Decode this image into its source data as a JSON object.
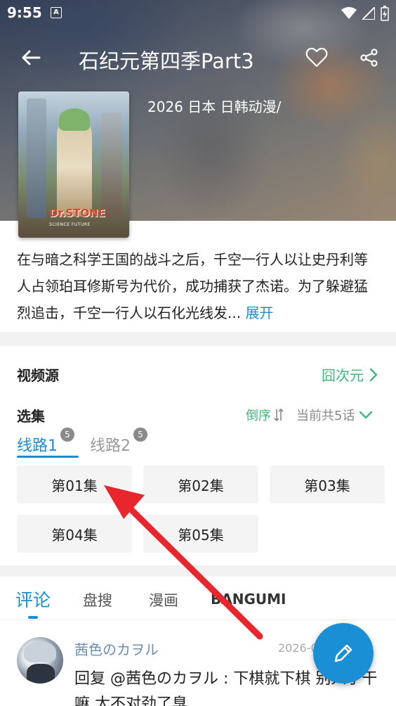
{
  "status": {
    "time": "9:55",
    "a_icon": "A"
  },
  "header": {
    "title": "石纪元第四季Part3",
    "meta": "2026 日本 日韩动漫/"
  },
  "poster": {
    "logo": "Dr.STONE",
    "subtitle": "SCIENCE FUTURE"
  },
  "description": {
    "text": "在与暗之科学王国的战斗之后，千空一行人以让史丹利等人占领珀耳修斯号为代价，成功捕获了杰诺。为了躲避猛烈追击，千空一行人以石化光线发...",
    "expand_label": "展开"
  },
  "source": {
    "label": "视频源",
    "value": "囧次元"
  },
  "episodes": {
    "label": "选集",
    "order_label": "倒序",
    "count_text": "当前共5话",
    "lines": [
      {
        "label": "线路1",
        "badge": "5"
      },
      {
        "label": "线路2",
        "badge": "5"
      }
    ],
    "items": [
      "第01集",
      "第02集",
      "第03集",
      "第04集",
      "第05集"
    ]
  },
  "tabs": [
    "评论",
    "盘搜",
    "漫画",
    "BANGUMI"
  ],
  "comment": {
    "user": "茜色のカヲル",
    "date": "2026-0",
    "text": "回复 @茜色のカヲル : 下棋就下棋 别人于干嘛 太不对劲了臭"
  },
  "colors": {
    "accent": "#1a8fd6",
    "green": "#3bb878",
    "annotation": "#e8262b"
  }
}
